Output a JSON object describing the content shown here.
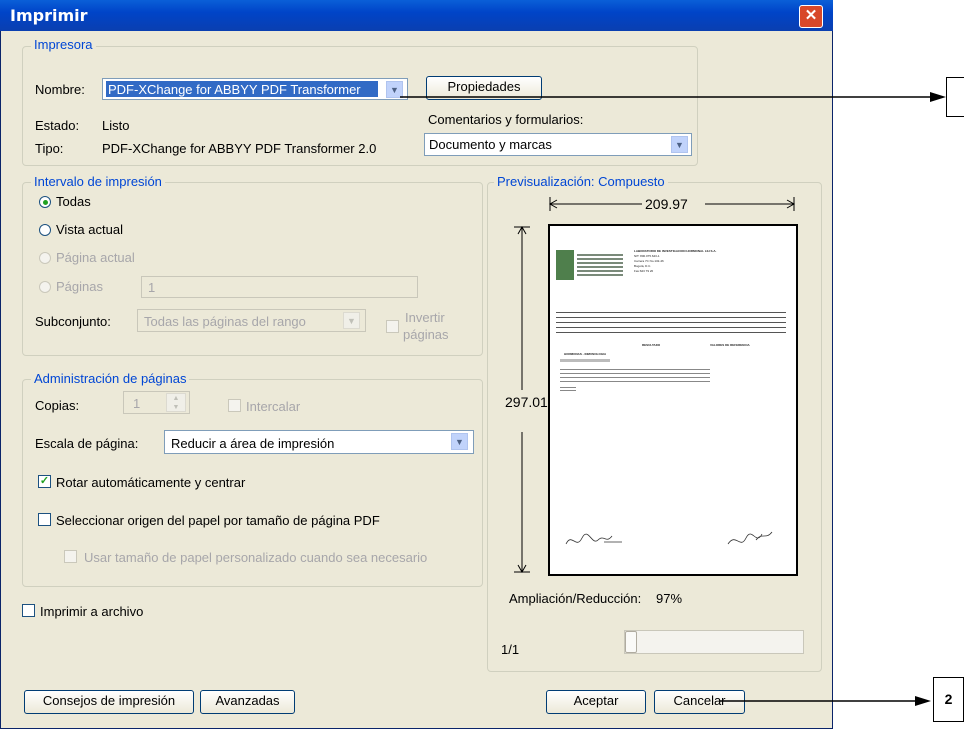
{
  "window": {
    "title": "Imprimir",
    "close_icon": "close-icon"
  },
  "printer": {
    "legend": "Impresora",
    "name_label": "Nombre:",
    "name_value": "PDF-XChange for ABBYY PDF Transformer",
    "properties_button": "Propiedades",
    "status_label": "Estado:",
    "status_value": "Listo",
    "type_label": "Tipo:",
    "type_value": "PDF-XChange for ABBYY PDF Transformer 2.0",
    "comments_label": "Comentarios y formularios:",
    "comments_value": "Documento y marcas"
  },
  "range": {
    "legend": "Intervalo de impresión",
    "all": "Todas",
    "current_view": "Vista actual",
    "current_page": "Página actual",
    "pages": "Páginas",
    "pages_value": "1",
    "subset_label": "Subconjunto:",
    "subset_value": "Todas las páginas del rango",
    "reverse_line1": "Invertir",
    "reverse_line2": "páginas"
  },
  "page_handling": {
    "legend": "Administración de páginas",
    "copies_label": "Copias:",
    "copies_value": "1",
    "collate": "Intercalar",
    "scale_label": "Escala de página:",
    "scale_value": "Reducir a área de impresión",
    "auto_rotate": "Rotar automáticamente y centrar",
    "auto_rotate_checked": true,
    "paper_source": "Seleccionar origen del papel por tamaño de página PDF",
    "paper_source_checked": false,
    "custom_paper": "Usar tamaño de papel personalizado cuando sea necesario"
  },
  "print_to_file": "Imprimir a archivo",
  "preview": {
    "legend": "Previsualización: Compuesto",
    "width": "209.97",
    "height": "297.01",
    "zoom_label": "Ampliación/Reducción:",
    "zoom_value": "97%",
    "page_indicator": "1/1",
    "doc": {
      "lab_name": "LABORATORIO DE INVESTIGACION HORMONAL LIH S.A.",
      "nit": "NIT: 800.075.643-1",
      "address": "Carrera 7C No.132-46",
      "city": "Bogotá, D.C.",
      "fax": "Fax:623 79 20",
      "section": "HORMONAS - INMUNOLOGIA",
      "results": "RESULTADO",
      "reference": "VALORES DE REFERENCIA"
    }
  },
  "buttons": {
    "tips": "Consejos de impresión",
    "advanced": "Avanzadas",
    "ok": "Aceptar",
    "cancel": "Cancelar"
  },
  "callouts": {
    "first": "",
    "second": "2"
  }
}
